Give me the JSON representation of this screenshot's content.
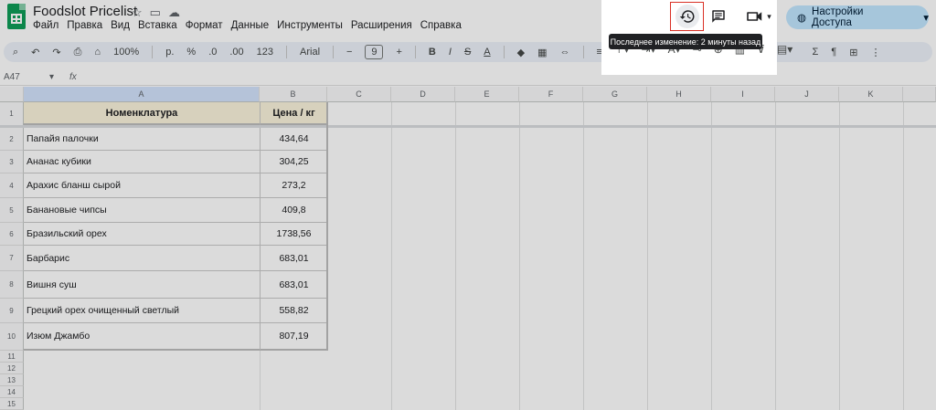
{
  "app": {
    "title": "Foodslot Pricelist",
    "title_icons": [
      "star-icon",
      "folder-move-icon",
      "cloud-status-icon"
    ],
    "menu": [
      "Файл",
      "Правка",
      "Вид",
      "Вставка",
      "Формат",
      "Данные",
      "Инструменты",
      "Расширения",
      "Справка"
    ],
    "share_label": "Настройки Доступа"
  },
  "toolbar": {
    "zoom": "100%",
    "currency": "р.",
    "percent": "%",
    "dec_decrease": ".0",
    "dec_increase": ".00",
    "number_format": "123",
    "font": "Arial",
    "font_size": "9"
  },
  "formula_bar": {
    "cell_ref": "A47",
    "fx": "fx"
  },
  "header_actions": {
    "tooltip": "Последнее изменение: 2 минуты назад"
  },
  "columns": [
    "A",
    "B",
    "C",
    "D",
    "E",
    "F",
    "G",
    "H",
    "I",
    "J",
    "K"
  ],
  "rows": [
    "1",
    "2",
    "3",
    "4",
    "5",
    "6",
    "7",
    "8",
    "9",
    "10",
    "11",
    "12",
    "13",
    "14",
    "15"
  ],
  "table": {
    "headers": [
      "Номенклатура",
      "Цена / кг"
    ],
    "rows": [
      {
        "name": "Папайя палочки",
        "price": "434,64"
      },
      {
        "name": "Ананас кубики",
        "price": "304,25"
      },
      {
        "name": "Арахис бланш сырой",
        "price": "273,2"
      },
      {
        "name": "Банановые чипсы",
        "price": "409,8"
      },
      {
        "name": "Бразильский орех",
        "price": "1738,56"
      },
      {
        "name": "Барбарис",
        "price": "683,01"
      },
      {
        "name": "Вишня суш",
        "price": "683,01"
      },
      {
        "name": "Грецкий орех очищенный  светлый",
        "price": "558,82"
      },
      {
        "name": "Изюм Джамбо",
        "price": "807,19"
      }
    ]
  },
  "colors": {
    "header_fill": "#fbf4dd",
    "highlight_border": "#d93025",
    "share_button": "#c2e7ff"
  }
}
